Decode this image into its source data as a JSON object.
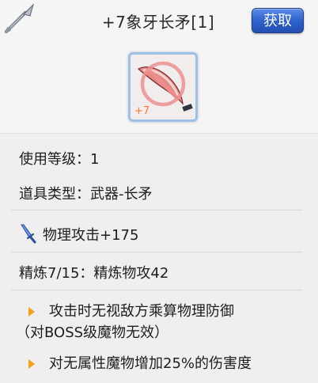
{
  "header": {
    "title": "+7象牙长矛[1]",
    "get_button": "获取",
    "item_level": "+7"
  },
  "stats": {
    "use_level": "使用等级：1",
    "item_type": "道具类型：武器-长矛",
    "physical_attack": "物理攻击+175",
    "refine": "精炼7/15：精炼物攻42"
  },
  "effects": [
    {
      "line1": "攻击时无视敌方乘算物理防御",
      "line2": "（对BOSS级魔物无效）"
    },
    {
      "line1": "对无属性魔物增加25%的伤害度"
    }
  ],
  "colors": {
    "accent_button": "#2d5fcb",
    "bullet": "#f3a21c",
    "refine_text": "#ff7a38"
  },
  "icons": [
    "spear-icon",
    "sword-icon",
    "arrow-right-icon",
    "prohibited-icon"
  ]
}
